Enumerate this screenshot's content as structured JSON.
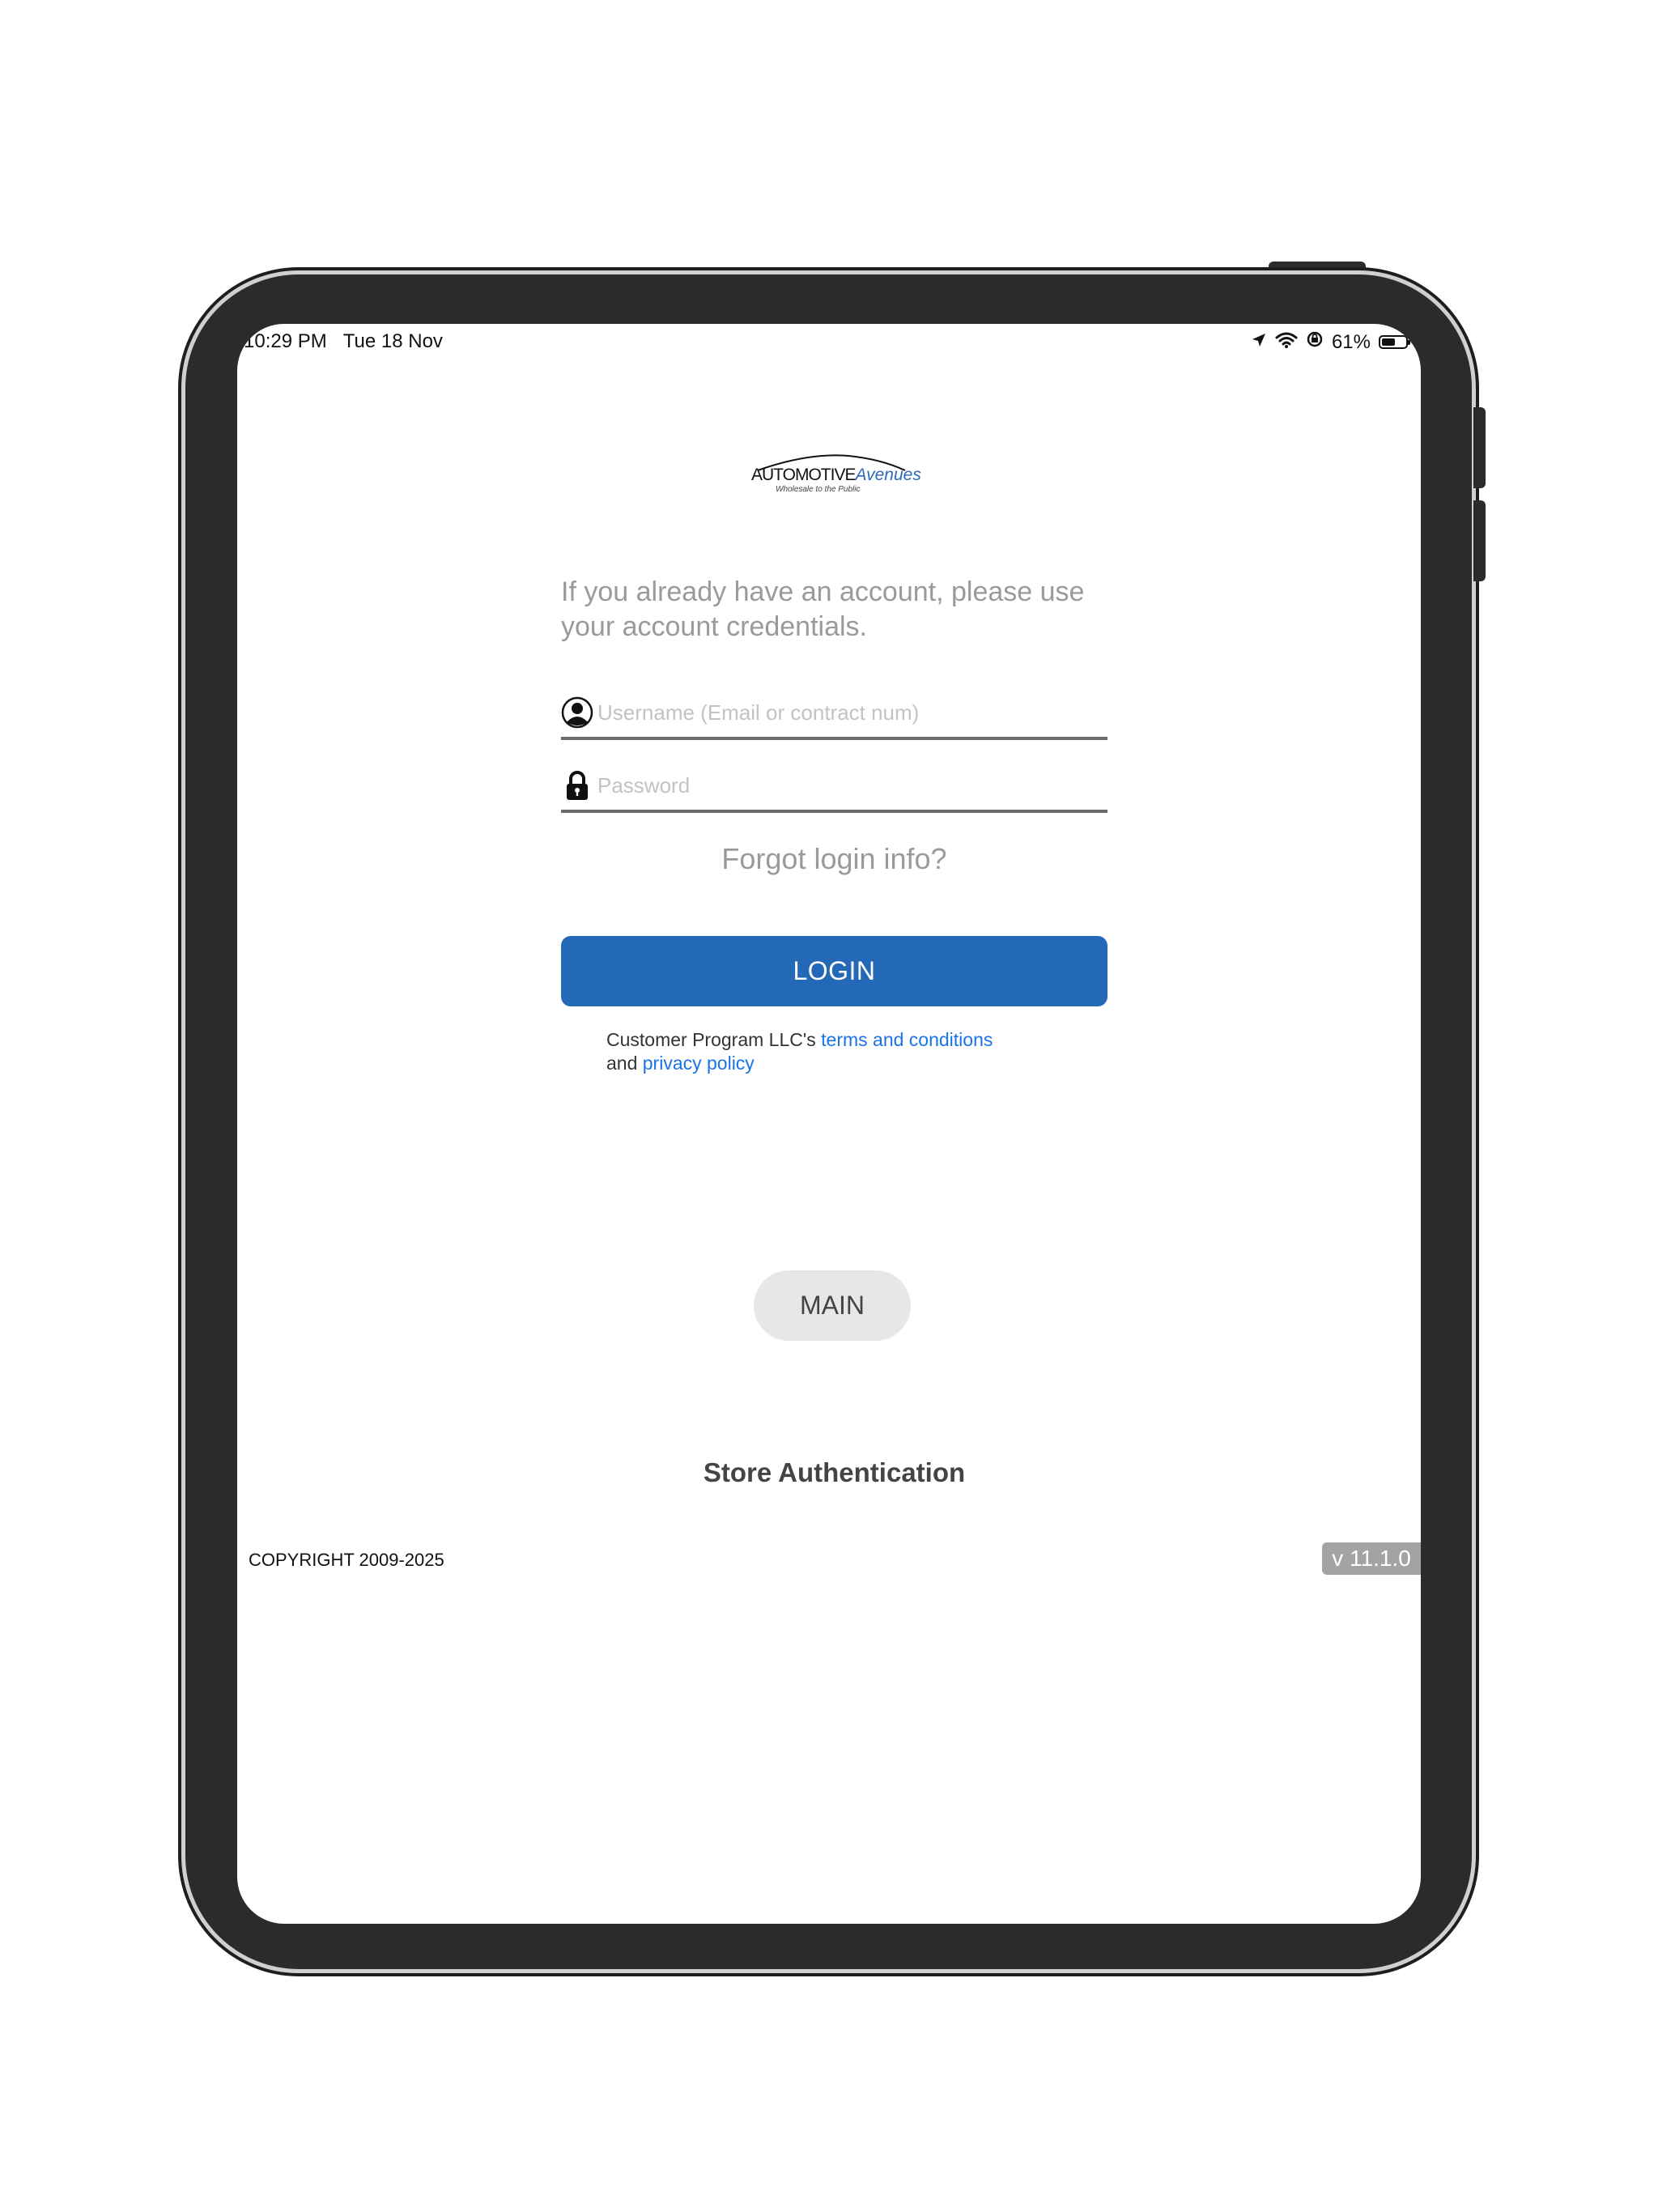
{
  "status_bar": {
    "time": "10:29 PM",
    "date": "Tue 18 Nov",
    "battery_percent": "61%",
    "battery_level": 0.61,
    "icons": [
      "location-arrow-icon",
      "wifi-icon",
      "orientation-lock-icon",
      "battery-icon"
    ]
  },
  "logo": {
    "brand_main": "AUTOMOTIVE",
    "brand_accent": "Avenues",
    "tagline": "Wholesale to the Public"
  },
  "login": {
    "intro": "If you already have an account, please use your account credentials.",
    "username_placeholder": "Username (Email or contract num)",
    "password_placeholder": "Password",
    "forgot_label": "Forgot login info?",
    "login_label": "LOGIN",
    "terms_prefix": "Customer Program LLC's ",
    "terms_link": "terms and conditions",
    "terms_and": "and ",
    "privacy_link": "privacy policy"
  },
  "main_button_label": "MAIN",
  "store_auth_label": "Store Authentication",
  "footer": {
    "copyright": "COPYRIGHT 2009-2025",
    "version": "v 11.1.0"
  },
  "colors": {
    "primary_button": "#2468b8",
    "link": "#1a73e8",
    "secondary_button": "#e7e7e7",
    "version_badge": "#a3a3a3",
    "device_frame": "#2b2b2b"
  }
}
